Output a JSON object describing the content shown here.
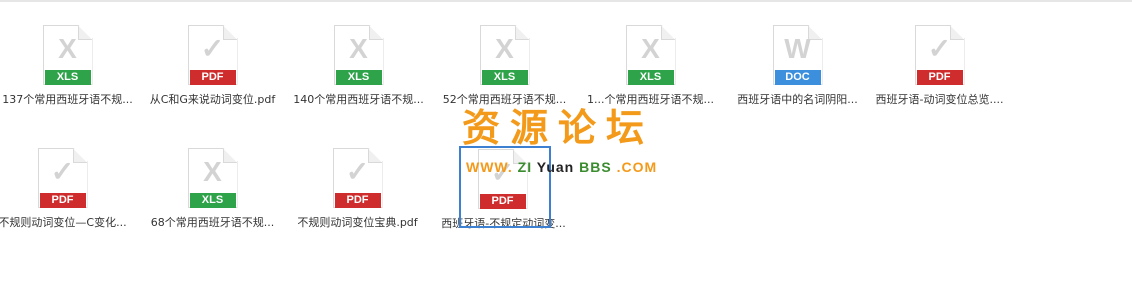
{
  "colors": {
    "xls": "#2fa34a",
    "pdf": "#cf2d2d",
    "doc": "#3b8fdd",
    "watermark_orange": "#f39a1a",
    "watermark_green": "#3a8c2f",
    "selection": "#3d7fd1"
  },
  "files": [
    {
      "name": "137个常用西班牙语不规...",
      "type": "XLS",
      "icon": "excel-file-icon",
      "glyph": "X"
    },
    {
      "name": "从C和G来说动词变位.pdf",
      "type": "PDF",
      "icon": "pdf-file-icon",
      "glyph": "✓"
    },
    {
      "name": "140个常用西班牙语不规...",
      "type": "XLS",
      "icon": "excel-file-icon",
      "glyph": "X"
    },
    {
      "name": "52个常用西班牙语不规...",
      "type": "XLS",
      "icon": "excel-file-icon",
      "glyph": "X"
    },
    {
      "name": "1...个常用西班牙语不规...",
      "type": "XLS",
      "icon": "excel-file-icon",
      "glyph": "X"
    },
    {
      "name": "西班牙语中的名词阴阳...",
      "type": "DOC",
      "icon": "word-file-icon",
      "glyph": "W"
    },
    {
      "name": "西班牙语-动词变位总览....",
      "type": "PDF",
      "icon": "pdf-file-icon",
      "glyph": "✓"
    },
    {
      "name": "不规则动词变位—C变化...",
      "type": "PDF",
      "icon": "pdf-file-icon",
      "glyph": "✓"
    },
    {
      "name": "68个常用西班牙语不规...",
      "type": "XLS",
      "icon": "excel-file-icon",
      "glyph": "X"
    },
    {
      "name": "不规则动词变位宝典.pdf",
      "type": "PDF",
      "icon": "pdf-file-icon",
      "glyph": "✓"
    },
    {
      "name": "西班牙语-不规定动词变...",
      "type": "PDF",
      "icon": "pdf-file-icon",
      "glyph": "✓"
    }
  ],
  "watermark": {
    "title": "资源论坛",
    "sub_www": "WWW.",
    "sub_zi": "ZI",
    "sub_yuan": "Yuan",
    "sub_bbs": "BBS",
    "sub_com": ".COM"
  }
}
